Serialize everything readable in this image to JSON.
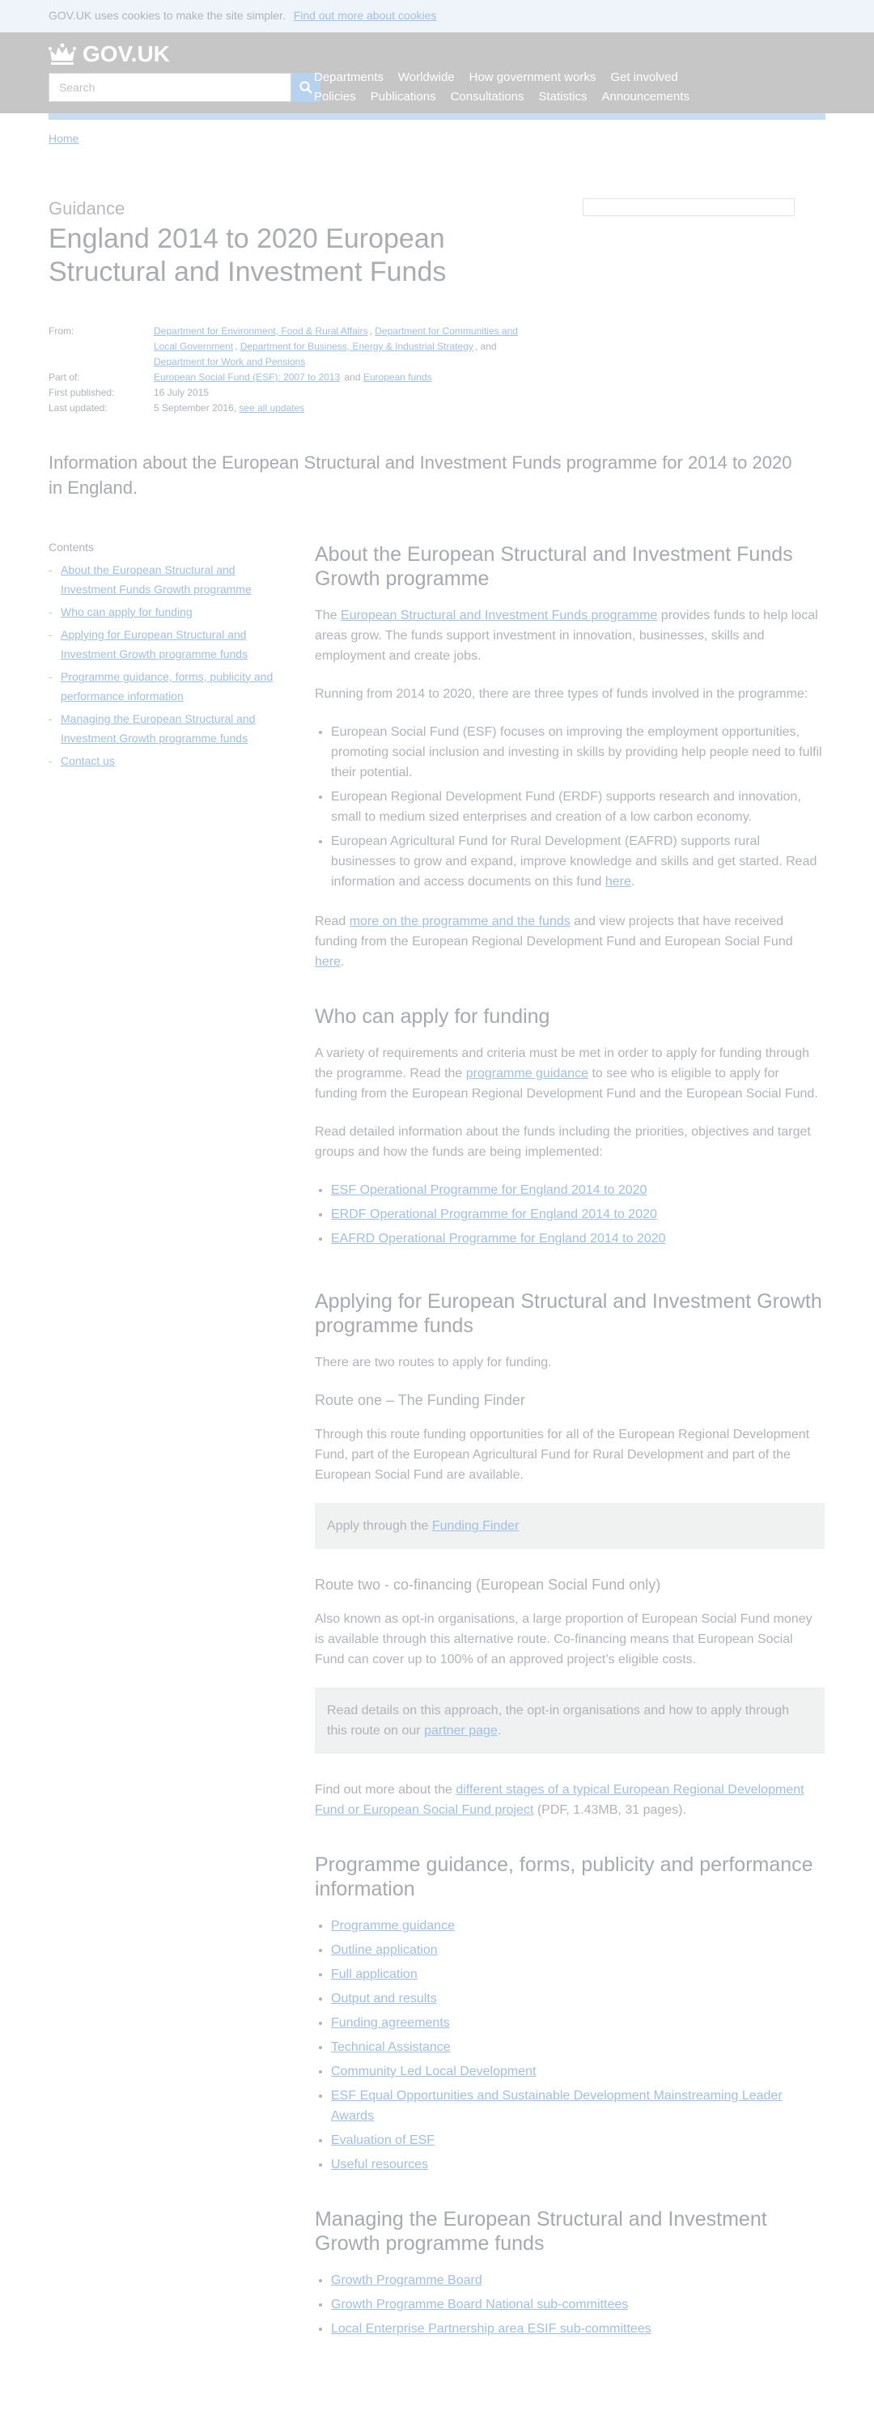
{
  "cookie": {
    "text": "GOV.UK uses cookies to make the site simpler.",
    "link": "Find out more about cookies"
  },
  "header": {
    "logo": "GOV.UK",
    "search_placeholder": "Search",
    "nav_row1": [
      "Departments",
      "Worldwide",
      "How government works",
      "Get involved"
    ],
    "nav_row2": [
      "Policies",
      "Publications",
      "Consultations",
      "Statistics",
      "Announcements"
    ]
  },
  "breadcrumb": {
    "home": "Home"
  },
  "page": {
    "format": "Guidance",
    "title": "England 2014 to 2020 European Structural and Investment Funds"
  },
  "metadata": {
    "from_label": "From:",
    "from_orgs": [
      "Department for Environment, Food & Rural Affairs",
      "Department for Communities and Local Government",
      "Department for Business, Energy & Industrial Strategy"
    ],
    "from_and": ", and",
    "from_last": "Department for Work and Pensions",
    "part_label": "Part of:",
    "part_of": [
      "European Social Fund (ESF): 2007 to 2013",
      "European funds"
    ],
    "part_and": "and",
    "first_label": "First published:",
    "first_value": "16 July 2015",
    "updated_label": "Last updated:",
    "updated_value": "5 September 2016,",
    "updated_link": "see all updates"
  },
  "summary": "Information about the European Structural and Investment Funds programme for 2014 to 2020 in England.",
  "contents": {
    "label": "Contents",
    "items": [
      "About the European Structural and Investment Funds Growth programme",
      "Who can apply for funding",
      "Applying for European Structural and Investment Growth programme funds",
      "Programme guidance, forms, publicity and performance information",
      "Managing the European Structural and Investment Growth programme funds",
      "Contact us"
    ]
  },
  "about": {
    "heading": "About the European Structural and Investment Funds Growth programme",
    "p1_pre": "The",
    "p1_link": "European Structural and Investment Funds programme",
    "p1_post": "provides funds to help local areas grow. The funds support investment in innovation, businesses, skills and employment and create jobs.",
    "p2": "Running from 2014 to 2020, there are three types of funds involved in the programme:",
    "bullet1": "European Social Fund (ESF) focuses on improving the employment opportunities, promoting social inclusion and investing in skills by providing help people need to fulfil their potential.",
    "bullet2": "European Regional Development Fund (ERDF) supports research and innovation, small to medium sized enterprises and creation of a low carbon economy.",
    "bullet3_pre": "European Agricultural Fund for Rural Development (EAFRD) supports rural businesses to grow and expand, improve knowledge and skills and get started. Read information and access documents on this fund",
    "bullet3_link": "here",
    "p3_pre": "Read",
    "p3_link": "more on the programme and the funds",
    "p3_mid": "and view projects that have received funding from the European Regional Development Fund and European Social Fund",
    "p3_link2": "here"
  },
  "who": {
    "heading": "Who can apply for funding",
    "p1_pre": "A variety of requirements and criteria must be met in order to apply for funding through the programme. Read the",
    "p1_link": "programme guidance",
    "p1_post": "to see who is eligible to apply for funding from the European Regional Development Fund and the European Social Fund.",
    "p2": "Read detailed information about the funds including the priorities, objectives and target groups and how the funds are being implemented:",
    "links": [
      "ESF Operational Programme for England 2014 to 2020",
      "ERDF Operational Programme for England 2014 to 2020",
      "EAFRD Operational Programme for England 2014 to 2020"
    ]
  },
  "applying": {
    "heading": "Applying for European Structural and Investment Growth programme funds",
    "intro": "There are two routes to apply for funding.",
    "route1_heading": "Route one – The Funding Finder",
    "route1_text": "Through this route funding opportunities for all of the European Regional Development Fund, part of the European Agricultural Fund for Rural Development and part of the European Social Fund are available.",
    "callout1_pre": "Apply through the",
    "callout1_link": "Funding Finder",
    "route2_heading": "Route two - co-financing (European Social Fund only)",
    "route2_text": "Also known as opt-in organisations, a large proportion of European Social Fund money is available through this alternative route. Co-financing means that European Social Fund can cover up to 100% of an approved project’s eligible costs.",
    "callout2_pre": "Read details on this approach, the opt-in organisations and how to apply through this route on our",
    "callout2_link": "partner page",
    "find_pre": "Find out more about the",
    "find_link": "different stages of a typical European Regional Development Fund or European Social Fund project",
    "find_post": "(PDF, 1.43MB, 31 pages)."
  },
  "guidance": {
    "heading": "Programme guidance, forms, publicity and performance information",
    "links": [
      "Programme guidance",
      "Outline application",
      "Full application",
      "Output and results",
      "Funding agreements",
      "Technical Assistance",
      "Community Led Local Development",
      "ESF Equal Opportunities and Sustainable Development Mainstreaming Leader Awards",
      "Evaluation of ESF",
      "Useful resources"
    ]
  },
  "managing": {
    "heading": "Managing the European Structural and Investment Growth programme funds",
    "links": [
      "Growth Programme Board",
      "Growth Programme Board National sub-committees",
      "Local Enterprise Partnership area ESIF sub-committees"
    ]
  }
}
